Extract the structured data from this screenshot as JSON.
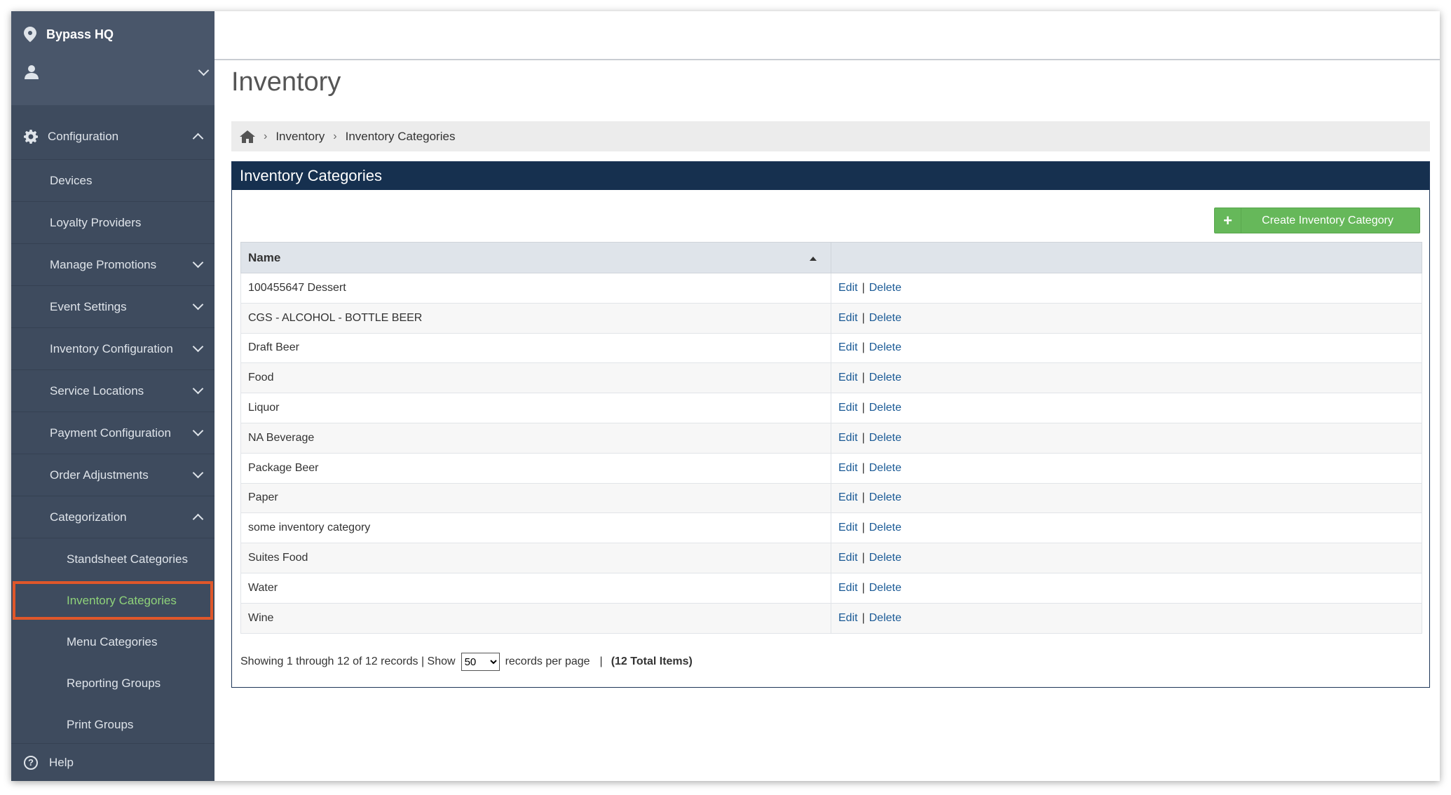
{
  "sidebar": {
    "venue": "Bypass HQ",
    "menu": [
      {
        "label": "Configuration",
        "type": "section",
        "expanded": true,
        "icon": "gear-icon"
      },
      {
        "label": "Devices",
        "type": "item"
      },
      {
        "label": "Loyalty Providers",
        "type": "item"
      },
      {
        "label": "Manage Promotions",
        "type": "item",
        "chevron": "down"
      },
      {
        "label": "Event Settings",
        "type": "item",
        "chevron": "down"
      },
      {
        "label": "Inventory Configuration",
        "type": "item",
        "chevron": "down"
      },
      {
        "label": "Service Locations",
        "type": "item",
        "chevron": "down"
      },
      {
        "label": "Payment Configuration",
        "type": "item",
        "chevron": "down"
      },
      {
        "label": "Order Adjustments",
        "type": "item",
        "chevron": "down"
      },
      {
        "label": "Categorization",
        "type": "item",
        "chevron": "up"
      },
      {
        "label": "Standsheet Categories",
        "type": "sub"
      },
      {
        "label": "Inventory Categories",
        "type": "sub",
        "active": true
      },
      {
        "label": "Menu Categories",
        "type": "sub"
      },
      {
        "label": "Reporting Groups",
        "type": "sub"
      },
      {
        "label": "Print Groups",
        "type": "sub"
      }
    ],
    "help": "Help"
  },
  "page": {
    "title": "Inventory",
    "breadcrumb": [
      "Inventory",
      "Inventory Categories"
    ]
  },
  "panel": {
    "title": "Inventory Categories",
    "create_label": "Create Inventory Category",
    "column_name": "Name",
    "edit_label": "Edit",
    "delete_label": "Delete",
    "rows": [
      "100455647 Dessert",
      "CGS - ALCOHOL - BOTTLE BEER",
      "Draft Beer",
      "Food",
      "Liquor",
      "NA Beverage",
      "Package Beer",
      "Paper",
      "some inventory category",
      "Suites Food",
      "Water",
      "Wine"
    ],
    "footer": {
      "showing": "Showing 1 through 12 of 12 records | Show",
      "per_page_value": "50",
      "per_page_suffix": "records per page",
      "separator": "|",
      "total": "(12 Total Items)"
    }
  },
  "colors": {
    "sidebar_bg": "#3e4b5e",
    "panel_header": "#16304f",
    "create_button": "#66b85a",
    "active_item_text": "#8fd37a",
    "active_outline": "#e0572a",
    "link": "#1a5a96"
  }
}
